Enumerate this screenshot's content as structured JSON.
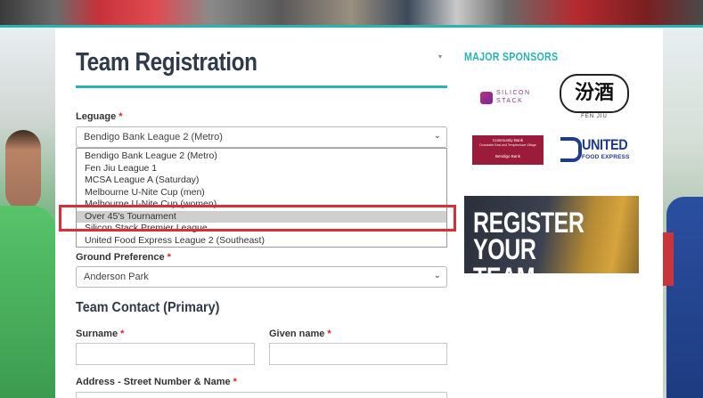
{
  "page": {
    "title": "Team Registration",
    "caret": "▾"
  },
  "form": {
    "league": {
      "label": "Leguage",
      "required_mark": "*",
      "selected_value": "Bendigo Bank League 2 (Metro)",
      "options": [
        "Bendigo Bank League 2 (Metro)",
        "Fen Jiu League 1",
        "MCSA League A (Saturday)",
        "Melbourne U-Nite Cup (men)",
        "Melbourne U-Nite Cup (women)",
        "Over 45's Tournament",
        "Silicon Stack Premier League",
        "United Food Express League 2 (Southeast)"
      ],
      "highlighted_option": "Over 45's Tournament"
    },
    "ground": {
      "label": "Ground Preference",
      "required_mark": "*",
      "selected_value": "Anderson Park"
    },
    "contact_heading": "Team Contact (Primary)",
    "surname": {
      "label": "Surname",
      "required_mark": "*",
      "value": ""
    },
    "given_name": {
      "label": "Given name",
      "required_mark": "*",
      "value": ""
    },
    "address": {
      "label": "Address - Street Number & Name",
      "required_mark": "*",
      "value": ""
    }
  },
  "sidebar": {
    "sponsors_title": "MAJOR SPONSORS",
    "sponsors": {
      "silicon": {
        "line1": "SILICON",
        "line2": "STACK"
      },
      "fenjiu": {
        "chars": "汾酒",
        "name": "FEN JIU"
      },
      "community": {
        "line1": "Community Bank",
        "line2": "Doncaster East and Templestowe Village",
        "line3": "Bendigo Bank"
      },
      "united": {
        "line1": "UNITED",
        "line2": "FOOD EXPRESS"
      }
    },
    "register_banner": {
      "line1": "REGISTER",
      "line2": "YOUR TEAM"
    }
  },
  "colors": {
    "accent": "#2bb3b3",
    "required": "#dd2222",
    "highlight_box": "#d8303a",
    "selected_option_bg": "#cfcfcf"
  },
  "icons": {
    "select_chevron": "chevron-down-icon",
    "title_caret": "caret-down-icon"
  }
}
